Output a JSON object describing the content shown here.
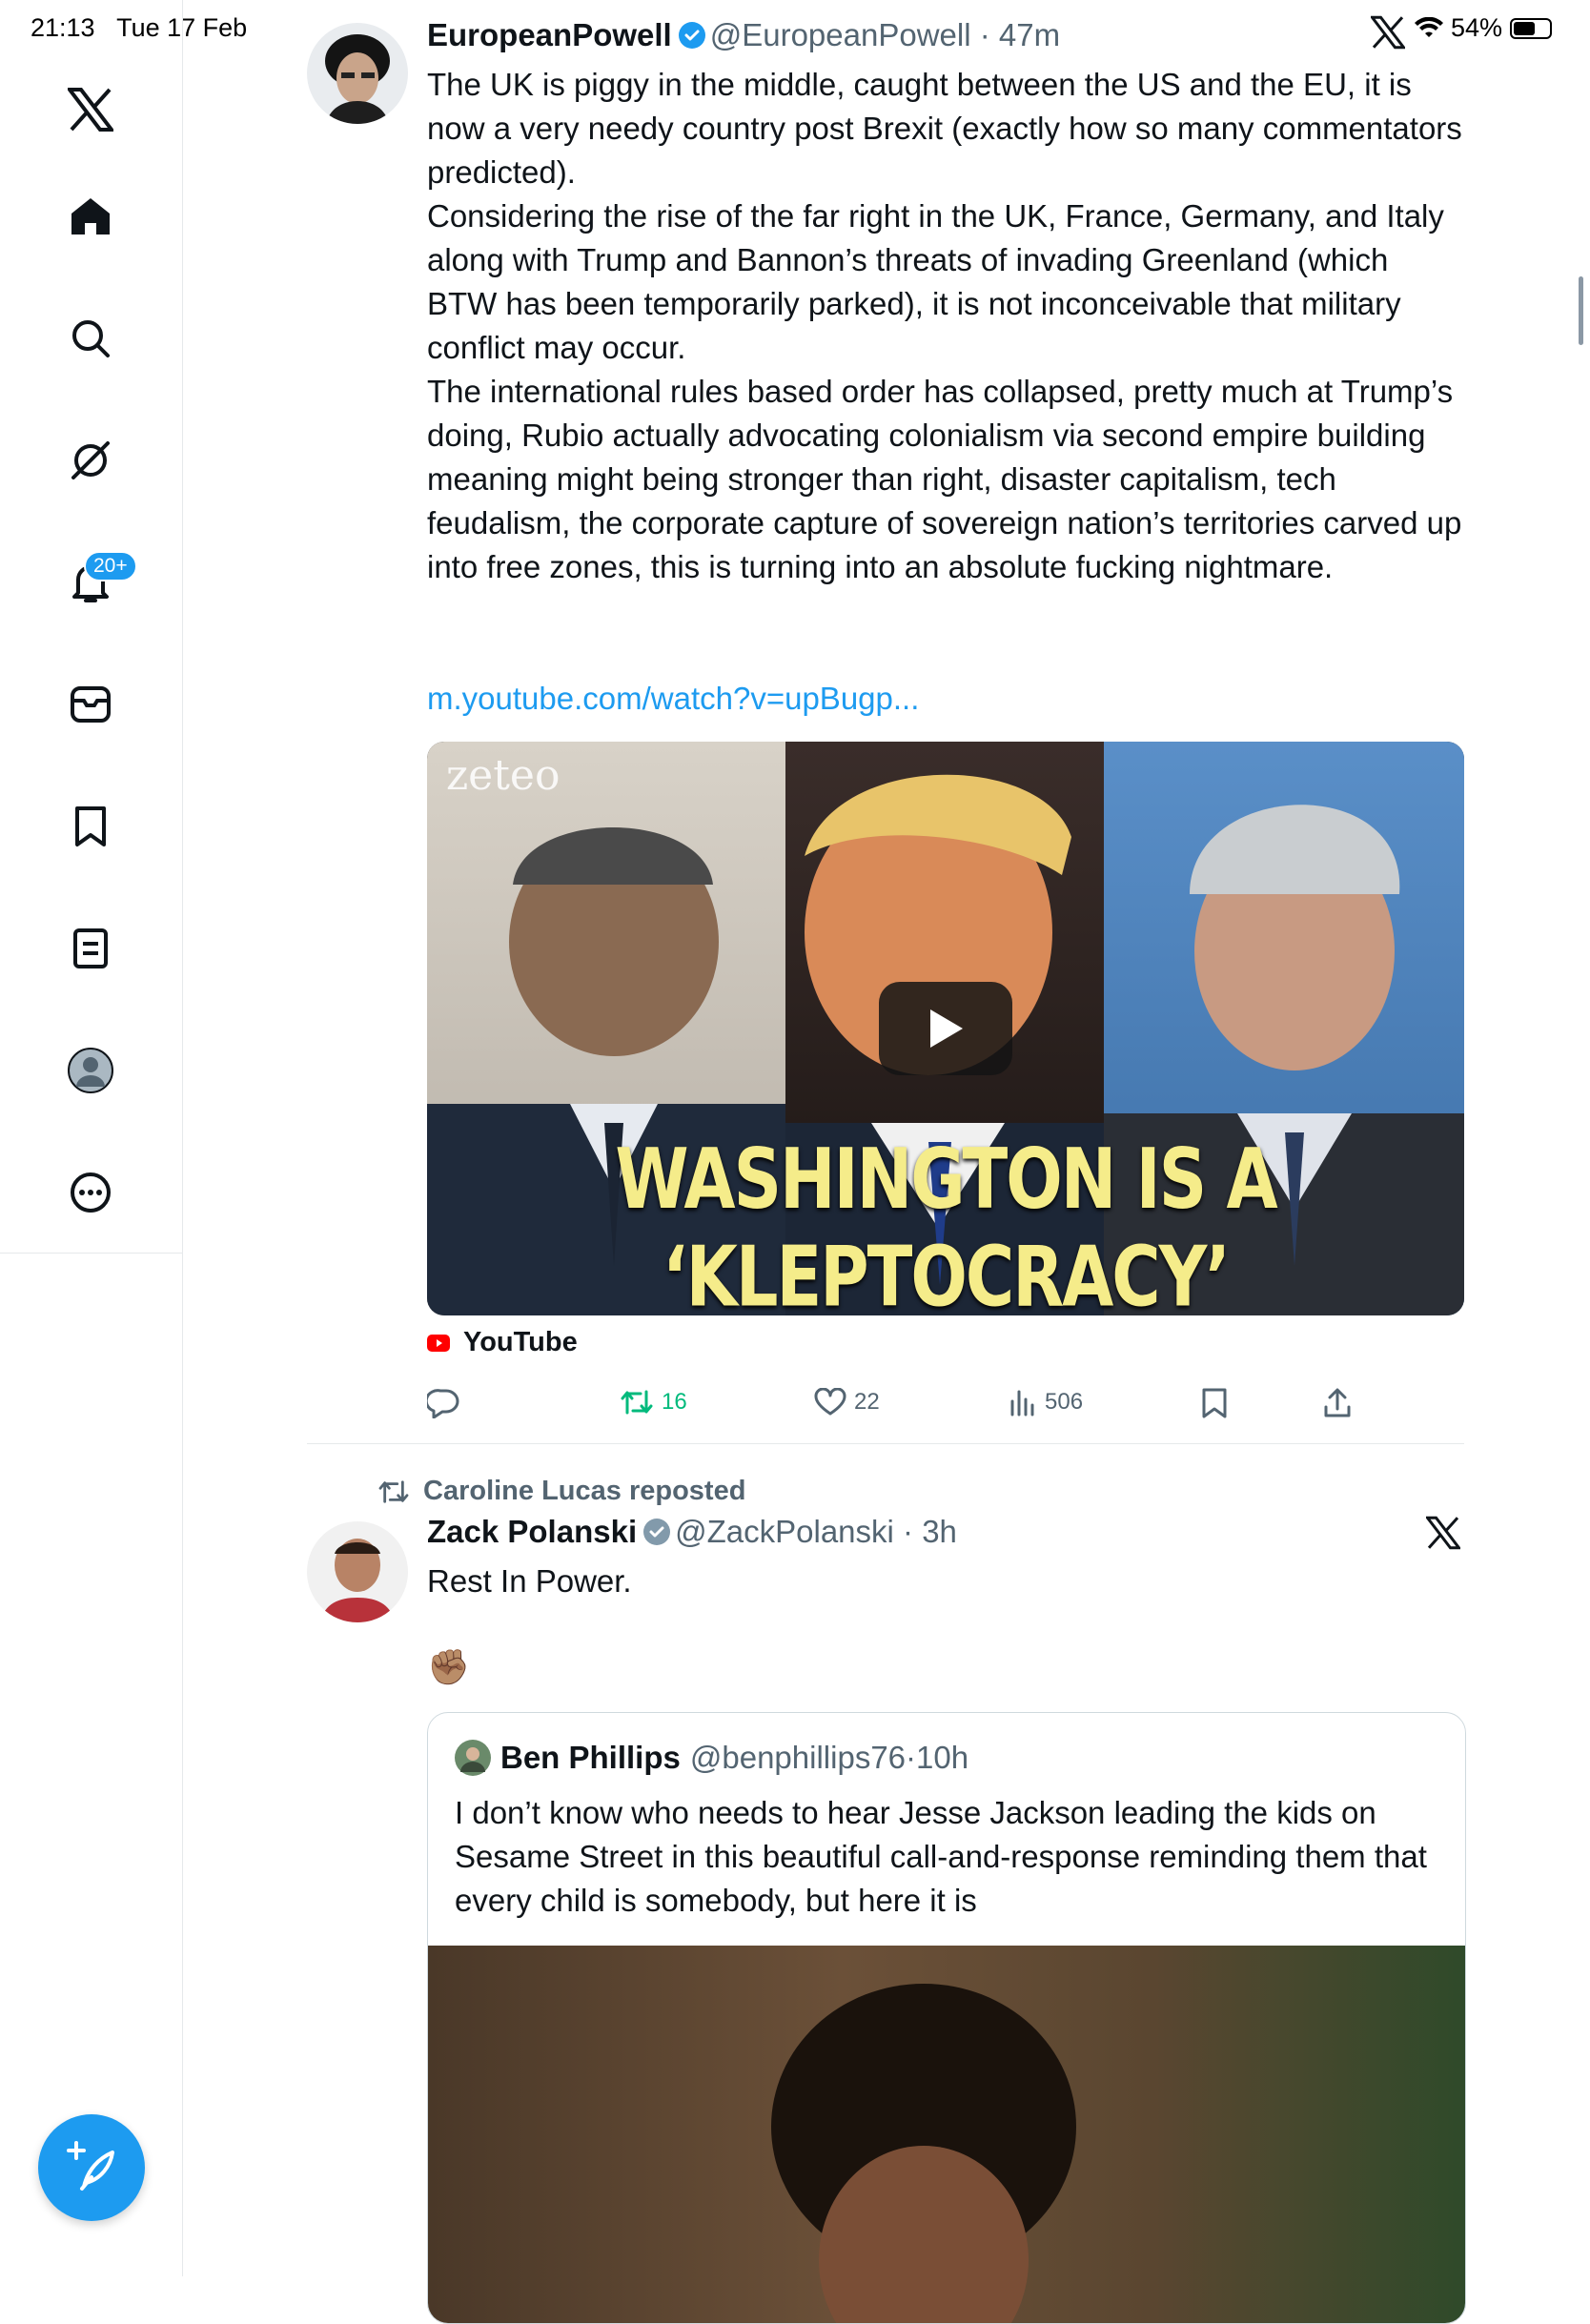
{
  "status_bar": {
    "time": "21:13",
    "date": "Tue 17 Feb",
    "battery": "54%",
    "battery_level": 0.54
  },
  "sidebar": {
    "items": [
      {
        "icon": "x-logo-icon"
      },
      {
        "icon": "home-icon"
      },
      {
        "icon": "search-icon"
      },
      {
        "icon": "grok-icon"
      },
      {
        "icon": "notifications-icon",
        "badge": "20+"
      },
      {
        "icon": "messages-icon"
      },
      {
        "icon": "bookmarks-icon"
      },
      {
        "icon": "lists-icon"
      },
      {
        "icon": "profile-icon"
      },
      {
        "icon": "more-icon"
      }
    ],
    "compose_icon": "compose-icon"
  },
  "tweet1": {
    "name": "EuropeanPowell",
    "handle": "@EuropeanPowell",
    "time": "47m",
    "paragraphs": [
      "The UK is piggy in the middle, caught between the US and the EU, it is now a very needy country post Brexit (exactly how so many commentators predicted).",
      "Considering the rise of the far right in the UK, France, Germany, and Italy along with Trump and Bannon’s threats of invading Greenland (which BTW has been temporarily parked), it is not inconceivable that military conflict may occur.",
      "The international rules based order has collapsed, pretty much at Trump’s doing, Rubio actually advocating colonialism via second empire building meaning might being stronger than right, disaster capitalism, tech feudalism, the corporate capture of sovereign nation’s territories carved up into free zones, this is turning into an absolute fucking nightmare."
    ],
    "link": "m.youtube.com/watch?v=upBugp...",
    "media": {
      "watermark": "zeteo",
      "caption": "WASHINGTON IS A ‘KLEPTOCRACY’"
    },
    "source": "YouTube",
    "actions": {
      "reposts": "16",
      "likes": "22",
      "views": "506"
    }
  },
  "tweet2": {
    "repost_label": "Caroline Lucas reposted",
    "name": "Zack Polanski",
    "handle": "@ZackPolanski",
    "time": "3h",
    "text": "Rest In Power.",
    "emoji": "✊🏽",
    "quote": {
      "name": "Ben Phillips",
      "handle": "@benphillips76",
      "time": "10h",
      "text": "I don’t know who needs to hear Jesse Jackson leading the kids on Sesame Street in this beautiful call-and-response reminding them that every child is somebody, but here it is"
    }
  }
}
